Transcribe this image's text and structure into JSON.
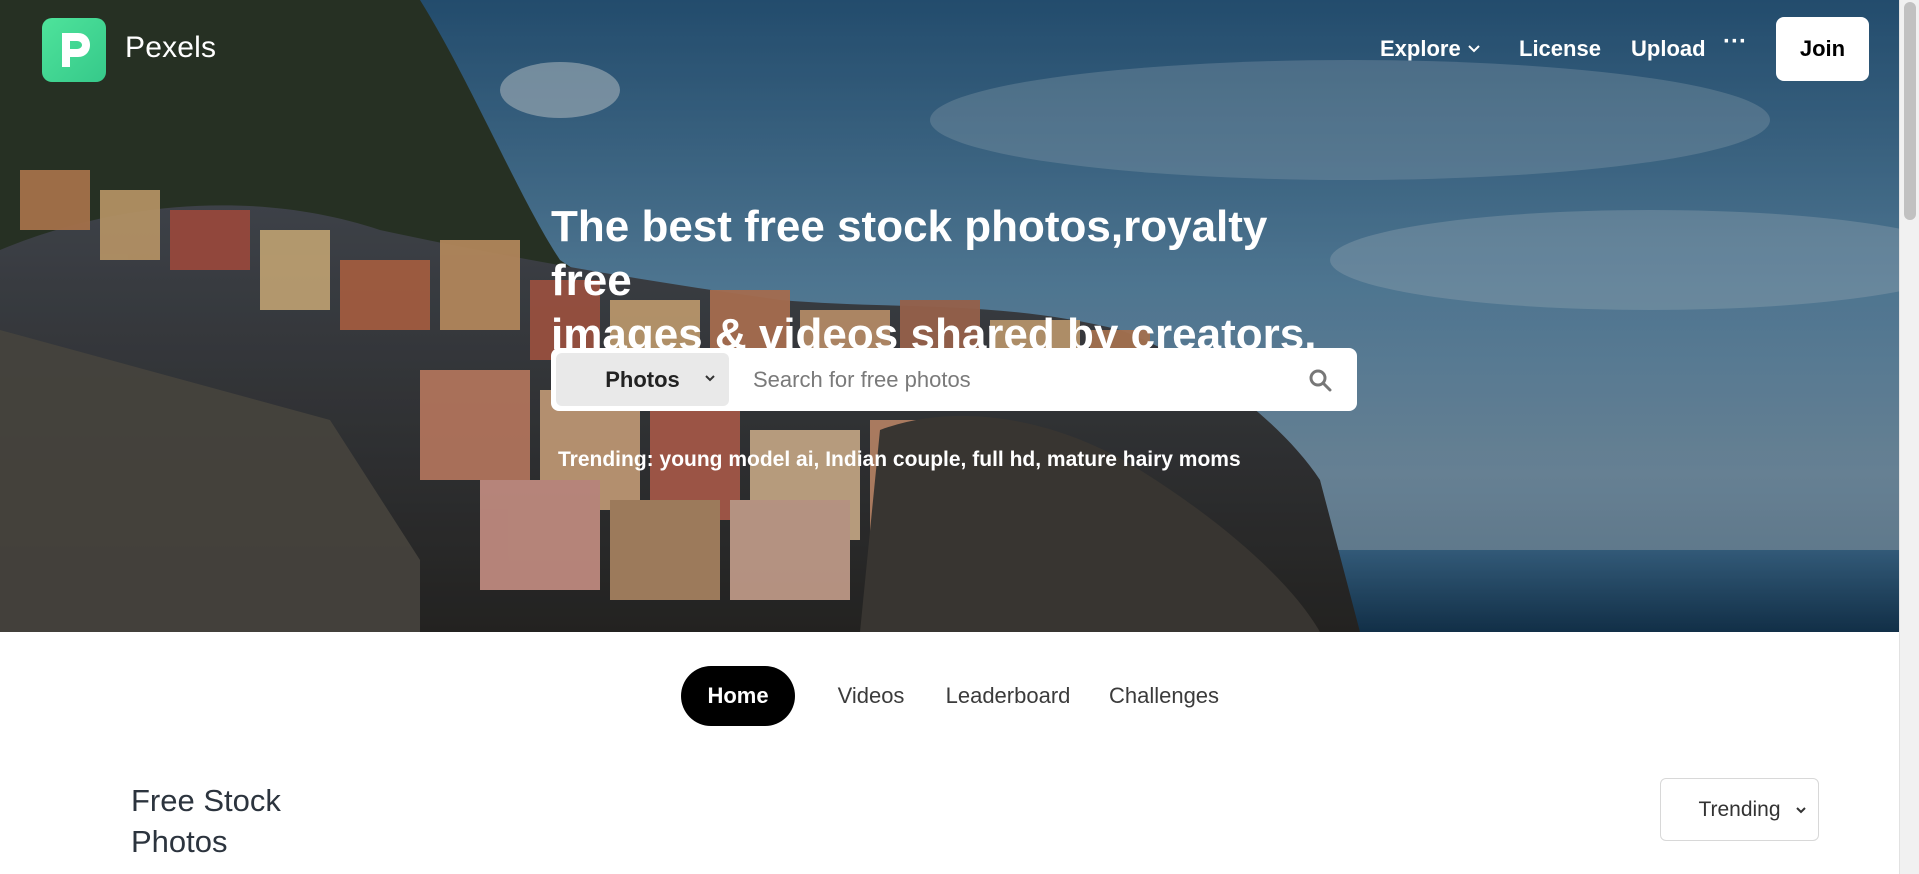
{
  "header": {
    "brand": "Pexels",
    "nav": {
      "explore": "Explore",
      "license": "License",
      "upload": "Upload",
      "more": "···",
      "join": "Join"
    }
  },
  "hero": {
    "headline_line1": "The best free stock photos,royalty free",
    "headline_line2": "images & videos shared by creators.",
    "search": {
      "type_selected": "Photos",
      "placeholder": "Search for free photos"
    },
    "trending": {
      "label": "Trending:",
      "items": [
        "young model ai,",
        "Indian couple,",
        "full hd,",
        "mature hairy moms"
      ]
    }
  },
  "tabs": [
    {
      "label": "Home",
      "active": true
    },
    {
      "label": "Videos",
      "active": false
    },
    {
      "label": "Leaderboard",
      "active": false
    },
    {
      "label": "Challenges",
      "active": false
    }
  ],
  "section": {
    "title_line1": "Free Stock",
    "title_line2": "Photos",
    "sort_selected": "Trending"
  },
  "colors": {
    "logo_green": "#4ee39b",
    "active_tab": "#000000",
    "title_text": "#2c343e"
  },
  "icons": {
    "logo": "pexels-logo-icon",
    "explore_chevron": "chevron-down-icon",
    "search": "search-icon",
    "more": "more-dots-icon"
  }
}
